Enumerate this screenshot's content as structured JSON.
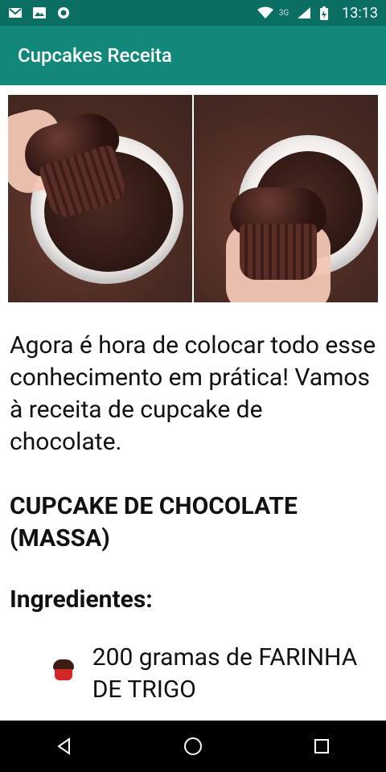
{
  "status_bar": {
    "time": "13:13",
    "network": "3G",
    "icons": [
      "mail-icon",
      "image-icon",
      "record-icon",
      "wifi-icon",
      "signal-icon",
      "battery-icon"
    ]
  },
  "app_bar": {
    "title": "Cupcakes Receita",
    "color": "#11887a"
  },
  "article": {
    "images": [
      "dipping-cupcake-photo",
      "glazed-cupcake-photo"
    ],
    "intro": "Agora é hora de colocar todo esse conhecimento em prática! Vamos à receita de cupcake de chocolate.",
    "section_title": "CUPCAKE DE CHOCOLATE (MASSA)",
    "ingredients_heading": "Ingredientes:",
    "ingredients": [
      "200 gramas de FARINHA DE TRIGO"
    ]
  },
  "nav_bar": {
    "buttons": [
      "back",
      "home",
      "recents"
    ]
  }
}
